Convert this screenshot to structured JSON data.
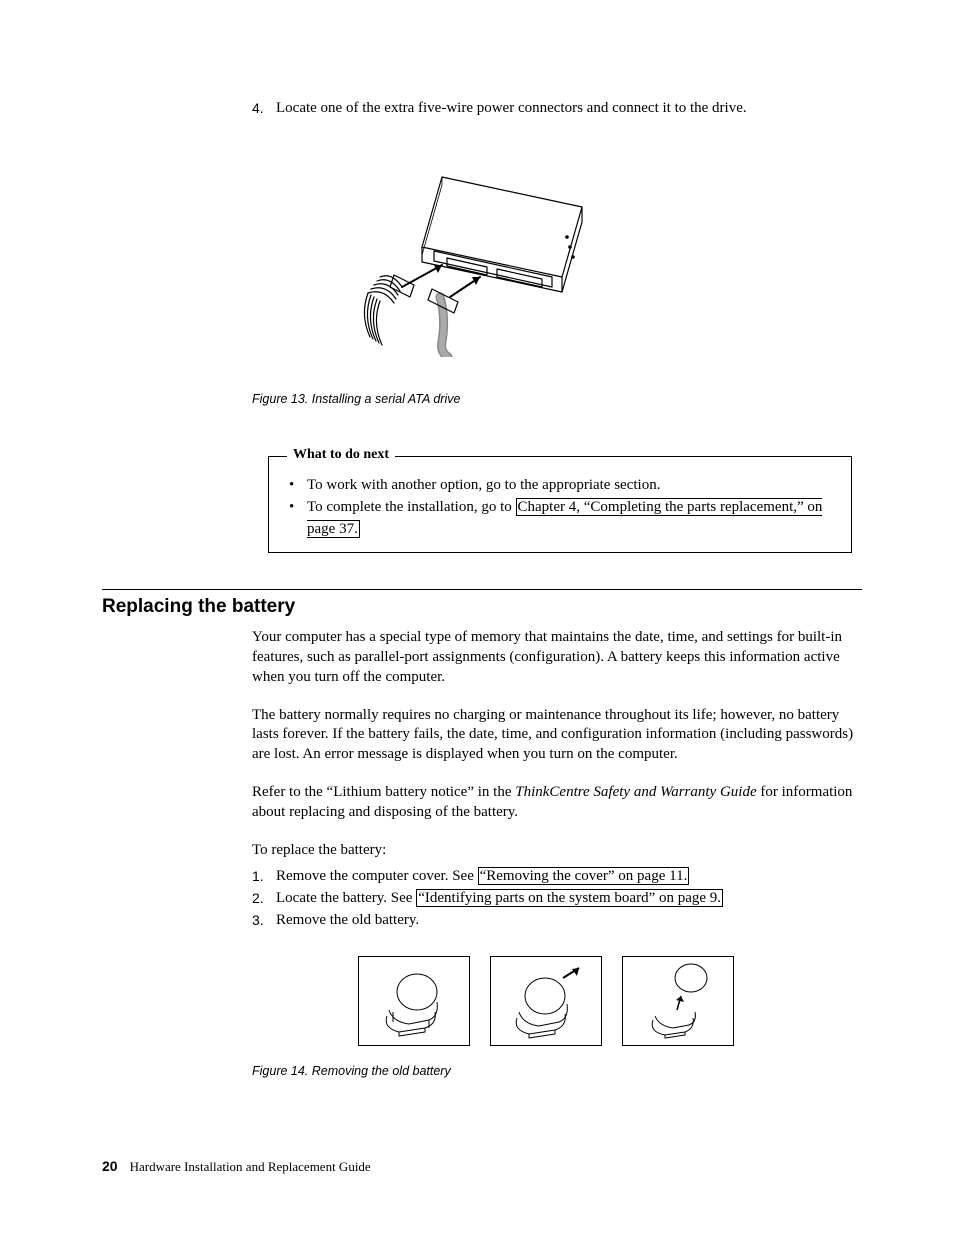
{
  "step4": {
    "num": "4.",
    "text": "Locate one of the extra five-wire power connectors and connect it to the drive."
  },
  "fig13_caption": "Figure 13. Installing a serial ATA drive",
  "callout": {
    "title": "What to do next",
    "item1_prefix": "To work with another option, go to the appropriate section.",
    "item2_prefix": "To complete the installation, go to ",
    "item2_link": "Chapter 4, “Completing the parts replacement,” on page 37."
  },
  "section_heading": "Replacing the battery",
  "para1": "Your computer has a special type of memory that maintains the date, time, and settings for built-in features, such as parallel-port assignments (configuration). A battery keeps this information active when you turn off the computer.",
  "para2": "The battery normally requires no charging or maintenance throughout its life; however, no battery lasts forever. If the battery fails, the date, time, and configuration information (including passwords) are lost. An error message is displayed when you turn on the computer.",
  "para3_a": "Refer to the “Lithium battery notice” in the ",
  "para3_i": "ThinkCentre Safety and Warranty Guide",
  "para3_b": " for information about replacing and disposing of the battery.",
  "para4": "To replace the battery:",
  "steps": {
    "s1": {
      "n": "1.",
      "t": "Remove the computer cover. See ",
      "l": "“Removing the cover” on page 11."
    },
    "s2": {
      "n": "2.",
      "t": "Locate the battery. See ",
      "l": "“Identifying parts on the system board” on page 9."
    },
    "s3": {
      "n": "3.",
      "t": "Remove the old battery."
    }
  },
  "fig14_caption": "Figure 14. Removing the old battery",
  "footer": {
    "page": "20",
    "title": "Hardware Installation and Replacement Guide"
  }
}
